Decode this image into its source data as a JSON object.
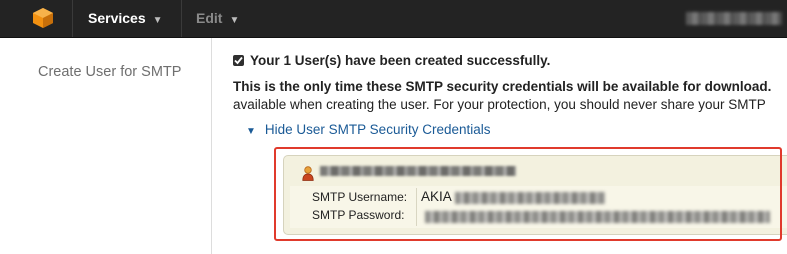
{
  "topbar": {
    "logo_icon": "aws-cube-icon",
    "services_label": "Services",
    "edit_label": "Edit"
  },
  "sidebar": {
    "title": "Create User for SMTP"
  },
  "main": {
    "success_message": "Your 1 User(s) have been created successfully.",
    "warning_bold": "This is the only time these SMTP security credentials will be available for download.",
    "warning_text": "available when creating the user. For your protection, you should never share your SMTP",
    "toggle_label": "Hide User SMTP Security Credentials",
    "credentials": {
      "username_label": "SMTP Username:",
      "username_value_prefix": "AKIA",
      "password_label": "SMTP Password:"
    }
  },
  "colors": {
    "topbar": "#232323",
    "link": "#1a5a96",
    "highlight": "#e03a2c",
    "panel": "#f3f1df"
  }
}
